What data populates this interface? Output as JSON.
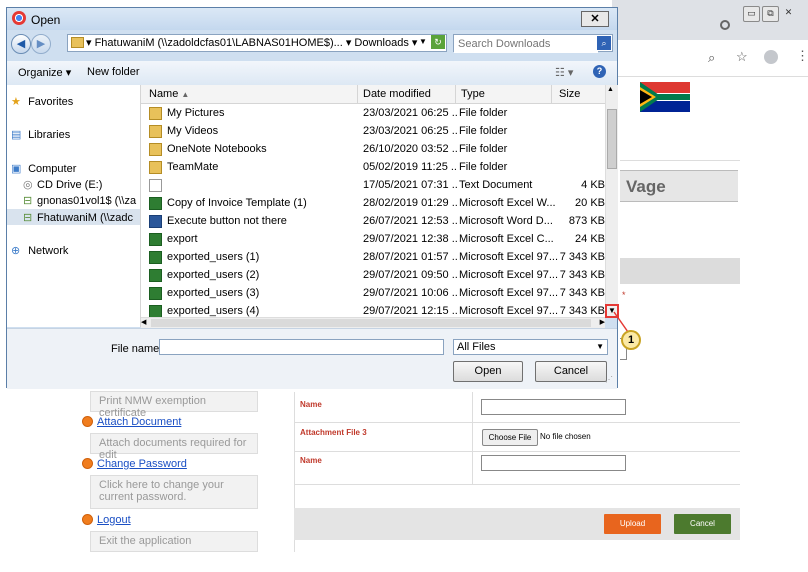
{
  "browser": {
    "window_controls": [
      "▭",
      "⧉",
      "✕"
    ],
    "toolbar_icons": [
      "zoom-icon",
      "star-icon",
      "profile-icon",
      "menu-icon"
    ]
  },
  "web": {
    "heading_fragment": "Vage",
    "sidebar": [
      {
        "box": "Print NMW exemption certificate"
      },
      {
        "link": "Attach Document",
        "box": "Attach documents required for edit"
      },
      {
        "link": "Change Password",
        "box": "Click here to change your current password."
      },
      {
        "link": "Logout",
        "box": "Exit the application"
      }
    ],
    "form": {
      "name_label": "Name",
      "attachment_label": "Attachment File 3",
      "choose_file": "Choose File",
      "no_file": "No file chosen",
      "name_label_2": "Name",
      "required_mark": "*",
      "upload": "Upload",
      "cancel": "Cancel"
    },
    "colors": {
      "upload": "#e8651e",
      "cancel": "#4c7a2e",
      "link": "#1a4fc4"
    }
  },
  "dialog": {
    "title": "Open",
    "path": "▾ FhatuwaniM (\\\\zadoldcfas01\\LABNAS01HOME$)... ▾ Downloads ▾",
    "search_placeholder": "Search Downloads",
    "organize": "Organize ▾",
    "new_folder": "New folder",
    "nav": [
      {
        "label": "Favorites",
        "icon": "star-icon"
      },
      {
        "label": "Libraries",
        "icon": "library-icon"
      },
      {
        "label": "Computer",
        "icon": "computer-icon"
      },
      {
        "label": "CD Drive (E:)",
        "icon": "cd-drive-icon"
      },
      {
        "label": "gnonas01vol1$ (\\\\za",
        "icon": "network-drive-icon"
      },
      {
        "label": "FhatuwaniM (\\\\zadc",
        "icon": "network-drive-icon"
      },
      {
        "label": "Network",
        "icon": "network-icon"
      }
    ],
    "columns": [
      "Name",
      "Date modified",
      "Type",
      "Size"
    ],
    "files": [
      {
        "name": "My Pictures",
        "date": "23/03/2021 06:25 ...",
        "type": "File folder",
        "size": "",
        "icon": "pictures-folder-icon"
      },
      {
        "name": "My Videos",
        "date": "23/03/2021 06:25 ...",
        "type": "File folder",
        "size": "",
        "icon": "videos-folder-icon"
      },
      {
        "name": "OneNote Notebooks",
        "date": "26/10/2020 03:52 ...",
        "type": "File folder",
        "size": "",
        "icon": "folder-icon"
      },
      {
        "name": "TeamMate",
        "date": "05/02/2019 11:25 ...",
        "type": "File folder",
        "size": "",
        "icon": "folder-icon"
      },
      {
        "name": "",
        "date": "17/05/2021 07:31 ...",
        "type": "Text Document",
        "size": "4 KB",
        "icon": "text-file-icon"
      },
      {
        "name": "Copy of Invoice Template (1)",
        "date": "28/02/2019 01:29 ...",
        "type": "Microsoft Excel W...",
        "size": "20 KB",
        "icon": "excel-file-icon"
      },
      {
        "name": "Execute button not there",
        "date": "26/07/2021 12:53 ...",
        "type": "Microsoft Word D...",
        "size": "873 KB",
        "icon": "word-file-icon"
      },
      {
        "name": "export",
        "date": "29/07/2021 12:38 ...",
        "type": "Microsoft Excel C...",
        "size": "24 KB",
        "icon": "excel-file-icon"
      },
      {
        "name": "exported_users (1)",
        "date": "28/07/2021 01:57 ...",
        "type": "Microsoft Excel 97...",
        "size": "7 343 KB",
        "icon": "excel-file-icon"
      },
      {
        "name": "exported_users (2)",
        "date": "29/07/2021 09:50 ...",
        "type": "Microsoft Excel 97...",
        "size": "7 343 KB",
        "icon": "excel-file-icon"
      },
      {
        "name": "exported_users (3)",
        "date": "29/07/2021 10:06 ...",
        "type": "Microsoft Excel 97...",
        "size": "7 343 KB",
        "icon": "excel-file-icon"
      },
      {
        "name": "exported_users (4)",
        "date": "29/07/2021 12:15 ...",
        "type": "Microsoft Excel 97...",
        "size": "7 343 KB",
        "icon": "excel-file-icon"
      }
    ],
    "file_name_label": "File name:",
    "file_name_value": "",
    "filter": "All Files",
    "open": "Open",
    "cancel": "Cancel",
    "callout": "1"
  }
}
